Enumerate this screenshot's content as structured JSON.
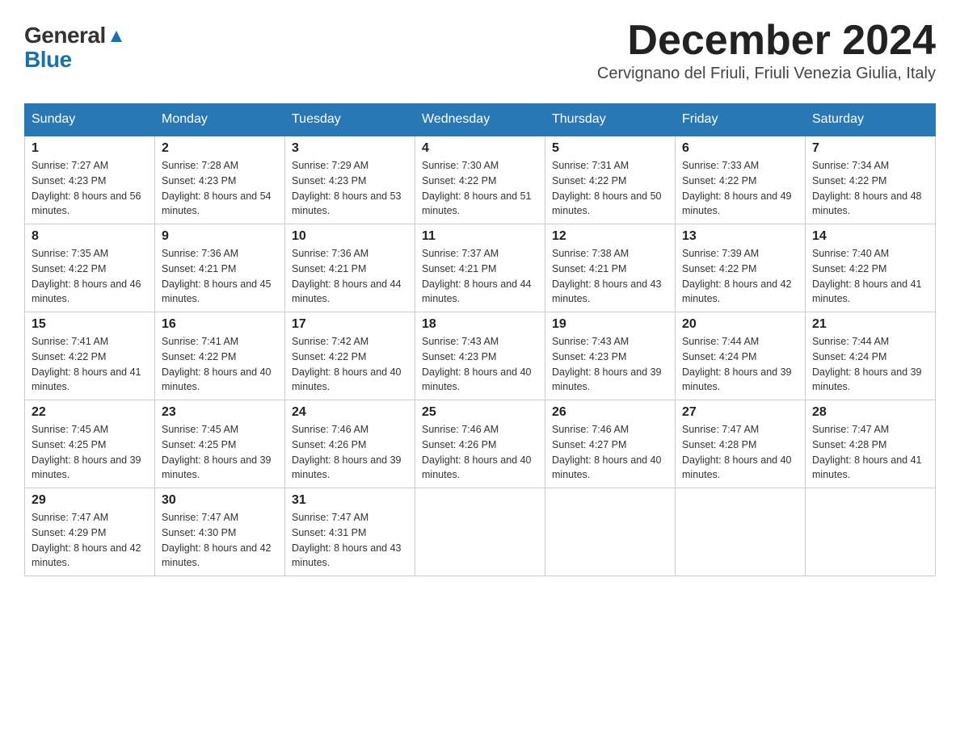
{
  "header": {
    "logo_general": "General",
    "logo_blue": "Blue",
    "month_title": "December 2024",
    "subtitle": "Cervignano del Friuli, Friuli Venezia Giulia, Italy"
  },
  "days_of_week": [
    "Sunday",
    "Monday",
    "Tuesday",
    "Wednesday",
    "Thursday",
    "Friday",
    "Saturday"
  ],
  "weeks": [
    [
      {
        "day": "1",
        "sunrise": "7:27 AM",
        "sunset": "4:23 PM",
        "daylight": "8 hours and 56 minutes."
      },
      {
        "day": "2",
        "sunrise": "7:28 AM",
        "sunset": "4:23 PM",
        "daylight": "8 hours and 54 minutes."
      },
      {
        "day": "3",
        "sunrise": "7:29 AM",
        "sunset": "4:23 PM",
        "daylight": "8 hours and 53 minutes."
      },
      {
        "day": "4",
        "sunrise": "7:30 AM",
        "sunset": "4:22 PM",
        "daylight": "8 hours and 51 minutes."
      },
      {
        "day": "5",
        "sunrise": "7:31 AM",
        "sunset": "4:22 PM",
        "daylight": "8 hours and 50 minutes."
      },
      {
        "day": "6",
        "sunrise": "7:33 AM",
        "sunset": "4:22 PM",
        "daylight": "8 hours and 49 minutes."
      },
      {
        "day": "7",
        "sunrise": "7:34 AM",
        "sunset": "4:22 PM",
        "daylight": "8 hours and 48 minutes."
      }
    ],
    [
      {
        "day": "8",
        "sunrise": "7:35 AM",
        "sunset": "4:22 PM",
        "daylight": "8 hours and 46 minutes."
      },
      {
        "day": "9",
        "sunrise": "7:36 AM",
        "sunset": "4:21 PM",
        "daylight": "8 hours and 45 minutes."
      },
      {
        "day": "10",
        "sunrise": "7:36 AM",
        "sunset": "4:21 PM",
        "daylight": "8 hours and 44 minutes."
      },
      {
        "day": "11",
        "sunrise": "7:37 AM",
        "sunset": "4:21 PM",
        "daylight": "8 hours and 44 minutes."
      },
      {
        "day": "12",
        "sunrise": "7:38 AM",
        "sunset": "4:21 PM",
        "daylight": "8 hours and 43 minutes."
      },
      {
        "day": "13",
        "sunrise": "7:39 AM",
        "sunset": "4:22 PM",
        "daylight": "8 hours and 42 minutes."
      },
      {
        "day": "14",
        "sunrise": "7:40 AM",
        "sunset": "4:22 PM",
        "daylight": "8 hours and 41 minutes."
      }
    ],
    [
      {
        "day": "15",
        "sunrise": "7:41 AM",
        "sunset": "4:22 PM",
        "daylight": "8 hours and 41 minutes."
      },
      {
        "day": "16",
        "sunrise": "7:41 AM",
        "sunset": "4:22 PM",
        "daylight": "8 hours and 40 minutes."
      },
      {
        "day": "17",
        "sunrise": "7:42 AM",
        "sunset": "4:22 PM",
        "daylight": "8 hours and 40 minutes."
      },
      {
        "day": "18",
        "sunrise": "7:43 AM",
        "sunset": "4:23 PM",
        "daylight": "8 hours and 40 minutes."
      },
      {
        "day": "19",
        "sunrise": "7:43 AM",
        "sunset": "4:23 PM",
        "daylight": "8 hours and 39 minutes."
      },
      {
        "day": "20",
        "sunrise": "7:44 AM",
        "sunset": "4:24 PM",
        "daylight": "8 hours and 39 minutes."
      },
      {
        "day": "21",
        "sunrise": "7:44 AM",
        "sunset": "4:24 PM",
        "daylight": "8 hours and 39 minutes."
      }
    ],
    [
      {
        "day": "22",
        "sunrise": "7:45 AM",
        "sunset": "4:25 PM",
        "daylight": "8 hours and 39 minutes."
      },
      {
        "day": "23",
        "sunrise": "7:45 AM",
        "sunset": "4:25 PM",
        "daylight": "8 hours and 39 minutes."
      },
      {
        "day": "24",
        "sunrise": "7:46 AM",
        "sunset": "4:26 PM",
        "daylight": "8 hours and 39 minutes."
      },
      {
        "day": "25",
        "sunrise": "7:46 AM",
        "sunset": "4:26 PM",
        "daylight": "8 hours and 40 minutes."
      },
      {
        "day": "26",
        "sunrise": "7:46 AM",
        "sunset": "4:27 PM",
        "daylight": "8 hours and 40 minutes."
      },
      {
        "day": "27",
        "sunrise": "7:47 AM",
        "sunset": "4:28 PM",
        "daylight": "8 hours and 40 minutes."
      },
      {
        "day": "28",
        "sunrise": "7:47 AM",
        "sunset": "4:28 PM",
        "daylight": "8 hours and 41 minutes."
      }
    ],
    [
      {
        "day": "29",
        "sunrise": "7:47 AM",
        "sunset": "4:29 PM",
        "daylight": "8 hours and 42 minutes."
      },
      {
        "day": "30",
        "sunrise": "7:47 AM",
        "sunset": "4:30 PM",
        "daylight": "8 hours and 42 minutes."
      },
      {
        "day": "31",
        "sunrise": "7:47 AM",
        "sunset": "4:31 PM",
        "daylight": "8 hours and 43 minutes."
      },
      null,
      null,
      null,
      null
    ]
  ]
}
